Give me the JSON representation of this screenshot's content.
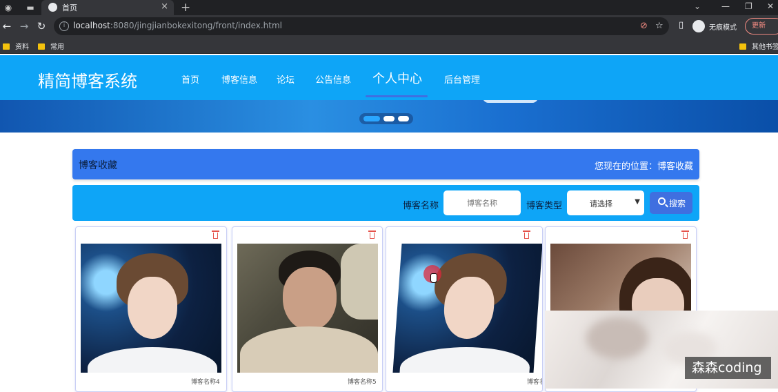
{
  "browser": {
    "tab_title": "首页",
    "url_host": "localhost",
    "url_rest": ":8080/jingjianbokexitong/front/index.html",
    "incognito_label": "无痕模式",
    "update_label": "更新",
    "bookmarks": [
      "资料",
      "常用"
    ],
    "other_bookmarks": "其他书签"
  },
  "site": {
    "logo": "精简博客系统",
    "nav": [
      "首页",
      "博客信息",
      "论坛",
      "公告信息",
      "个人中心",
      "后台管理"
    ],
    "active_nav": "个人中心"
  },
  "breadcrumb": {
    "title": "博客收藏",
    "location": "您现在的位置：博客收藏"
  },
  "search": {
    "name_label": "博客名称",
    "name_placeholder": "博客名称",
    "type_label": "博客类型",
    "type_value": "请选择",
    "button_label": "搜索"
  },
  "cards": [
    {
      "caption": "博客名称4"
    },
    {
      "caption": "博客名称5"
    },
    {
      "caption": "博客名"
    },
    {
      "caption": ""
    }
  ],
  "watermark": "森森coding",
  "colors": {
    "header": "#0ea5f7",
    "breadcrumb": "#3478ee",
    "button": "#3f6fe0",
    "delete": "#e5534b"
  }
}
